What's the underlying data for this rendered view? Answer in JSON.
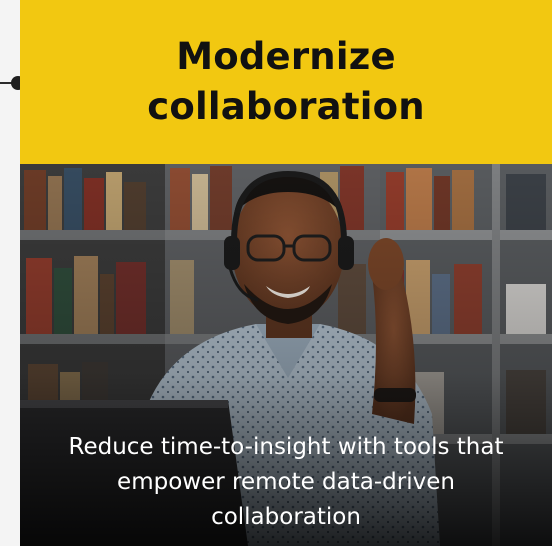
{
  "card": {
    "title": "Modernize collaboration",
    "caption": "Reduce time-to-insight with tools that empower remote data-driven collaboration",
    "header_color": "#f2c811",
    "photo_icon": "person-with-headset-photo"
  }
}
